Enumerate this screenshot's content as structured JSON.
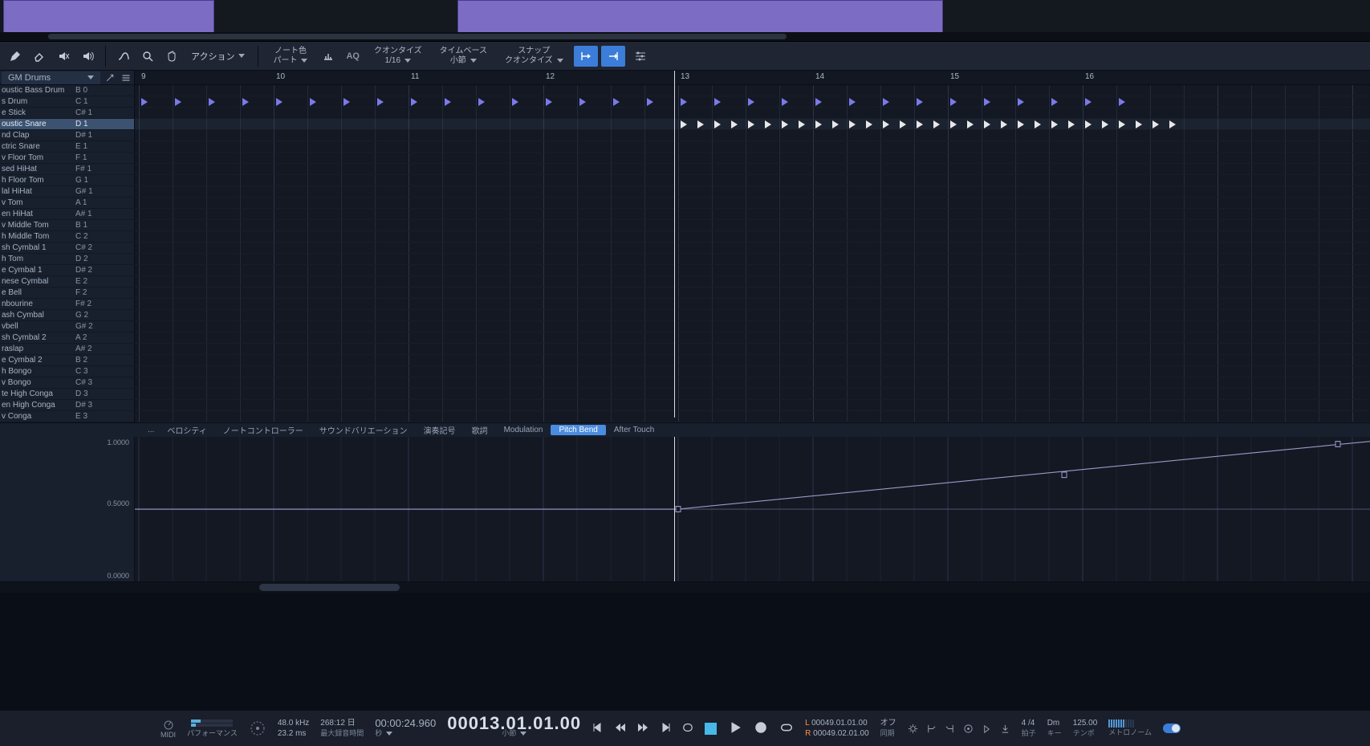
{
  "drum_map": "GM Drums",
  "toolbar": {
    "action": "アクション",
    "note_color": {
      "label": "ノート色",
      "value": "パート"
    },
    "quantize": {
      "label": "クオンタイズ",
      "value": "1/16"
    },
    "timebase": {
      "label": "タイムベース",
      "value": "小節"
    },
    "snap": {
      "label": "スナップ",
      "value": "クオンタイズ"
    },
    "aq": "AQ"
  },
  "drums": [
    {
      "name": "oustic Bass Drum",
      "pitch": "B 0"
    },
    {
      "name": "s Drum",
      "pitch": "C 1"
    },
    {
      "name": "e Stick",
      "pitch": "C# 1"
    },
    {
      "name": "oustic Snare",
      "pitch": "D 1",
      "selected": true
    },
    {
      "name": "nd Clap",
      "pitch": "D# 1"
    },
    {
      "name": "ctric Snare",
      "pitch": "E 1"
    },
    {
      "name": "v Floor Tom",
      "pitch": "F 1"
    },
    {
      "name": "sed HiHat",
      "pitch": "F# 1"
    },
    {
      "name": "h Floor Tom",
      "pitch": "G 1"
    },
    {
      "name": "lal HiHat",
      "pitch": "G# 1"
    },
    {
      "name": "v Tom",
      "pitch": "A 1"
    },
    {
      "name": "en HiHat",
      "pitch": "A# 1"
    },
    {
      "name": "v Middle Tom",
      "pitch": "B 1"
    },
    {
      "name": "h Middle Tom",
      "pitch": "C 2"
    },
    {
      "name": "sh Cymbal 1",
      "pitch": "C# 2"
    },
    {
      "name": "h Tom",
      "pitch": "D 2"
    },
    {
      "name": "e Cymbal 1",
      "pitch": "D# 2"
    },
    {
      "name": "nese Cymbal",
      "pitch": "E 2"
    },
    {
      "name": "e Bell",
      "pitch": "F 2"
    },
    {
      "name": "nbourine",
      "pitch": "F# 2"
    },
    {
      "name": "ash Cymbal",
      "pitch": "G 2"
    },
    {
      "name": "vbell",
      "pitch": "G# 2"
    },
    {
      "name": "sh Cymbal 2",
      "pitch": "A 2"
    },
    {
      "name": "raslap",
      "pitch": "A# 2"
    },
    {
      "name": "e Cymbal 2",
      "pitch": "B 2"
    },
    {
      "name": "h Bongo",
      "pitch": "C 3"
    },
    {
      "name": "v Bongo",
      "pitch": "C# 3"
    },
    {
      "name": "te High Conga",
      "pitch": "D 3"
    },
    {
      "name": "en High Conga",
      "pitch": "D# 3"
    },
    {
      "name": "v Conga",
      "pitch": "E 3"
    }
  ],
  "ruler_bars": [
    9,
    10,
    11,
    12,
    13,
    14,
    15,
    16
  ],
  "ctrl_tabs": [
    "...",
    "ベロシティ",
    "ノートコントローラー",
    "サウンドバリエーション",
    "演奏記号",
    "歌詞",
    "Modulation",
    "Pitch Bend",
    "After Touch"
  ],
  "ctrl_active": "Pitch Bend",
  "ctrl_axis": {
    "top": "1.0000",
    "mid": "0.5000",
    "bot": "0.0000"
  },
  "transport": {
    "midi": "MIDI",
    "perf": "パフォーマンス",
    "sr": "48.0 kHz",
    "lat": "23.2 ms",
    "rec_remain": "268:12 日",
    "rec_label": "最大録音時間",
    "time": "00:00:24.960",
    "time_label": "秒",
    "pos": "00013.01.01.00",
    "pos_label": "小節",
    "L": "00049.01.01.00",
    "R": "00049.02.01.00",
    "punch": "オフ",
    "sync": "同期",
    "sig": "4 /4",
    "key": "Dm",
    "tempo": "125.00",
    "metronome": "メトロノーム",
    "beat": "拍子",
    "key_lbl": "キー",
    "tempo_lbl": "テンポ"
  }
}
